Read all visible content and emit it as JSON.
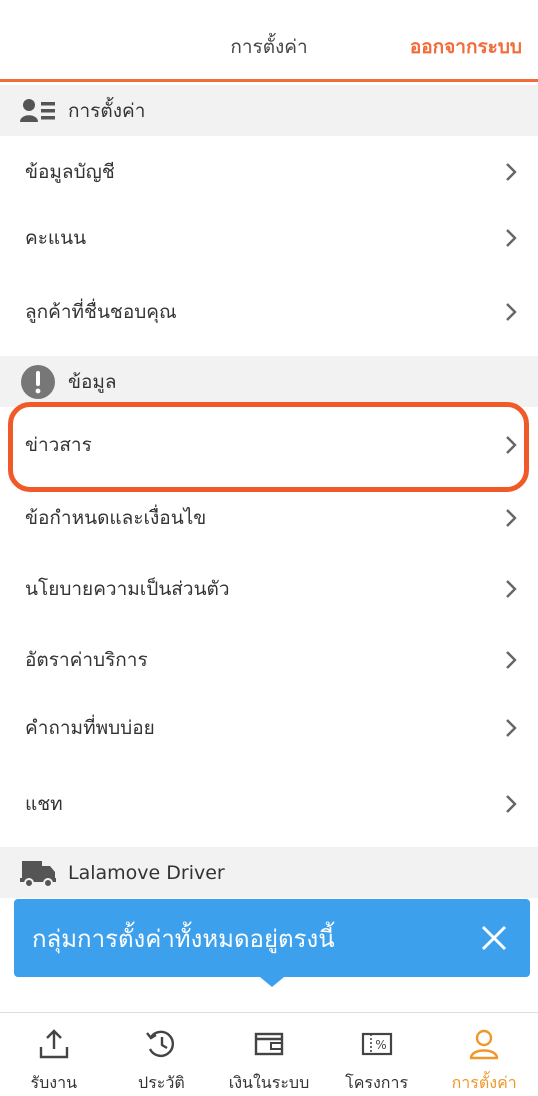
{
  "header": {
    "title": "การตั้งค่า",
    "logout_label": "ออกจากระบบ"
  },
  "colors": {
    "accent": "#f26b3a",
    "tooltip": "#3ca0ed",
    "active_tab": "#f0972a"
  },
  "sections": [
    {
      "label": "การตั้งค่า",
      "icon": "user-list-icon"
    },
    {
      "label": "ข้อมูล",
      "icon": "info-icon"
    },
    {
      "label": "Lalamove Driver",
      "icon": "truck-icon"
    }
  ],
  "account_items": [
    {
      "label": "ข้อมูลบัญชี"
    },
    {
      "label": "คะแนน"
    },
    {
      "label": "ลูกค้าที่ชื่นชอบคุณ"
    }
  ],
  "info_items": [
    {
      "label": "ข่าวสาร"
    },
    {
      "label": "ข้อกำหนดและเงื่อนไข"
    },
    {
      "label": "นโยบายความเป็นส่วนตัว"
    },
    {
      "label": "อัตราค่าบริการ"
    },
    {
      "label": "คำถามที่พบบ่อย"
    },
    {
      "label": "แชท"
    }
  ],
  "tooltip": {
    "text": "กลุ่มการตั้งค่าทั้งหมดอยู่ตรงนี้"
  },
  "tabs": [
    {
      "label": "รับงาน",
      "icon": "upload-icon"
    },
    {
      "label": "ประวัติ",
      "icon": "history-icon"
    },
    {
      "label": "เงินในระบบ",
      "icon": "wallet-icon"
    },
    {
      "label": "โครงการ",
      "icon": "coupon-icon"
    },
    {
      "label": "การตั้งค่า",
      "icon": "user-icon",
      "active": true
    }
  ]
}
